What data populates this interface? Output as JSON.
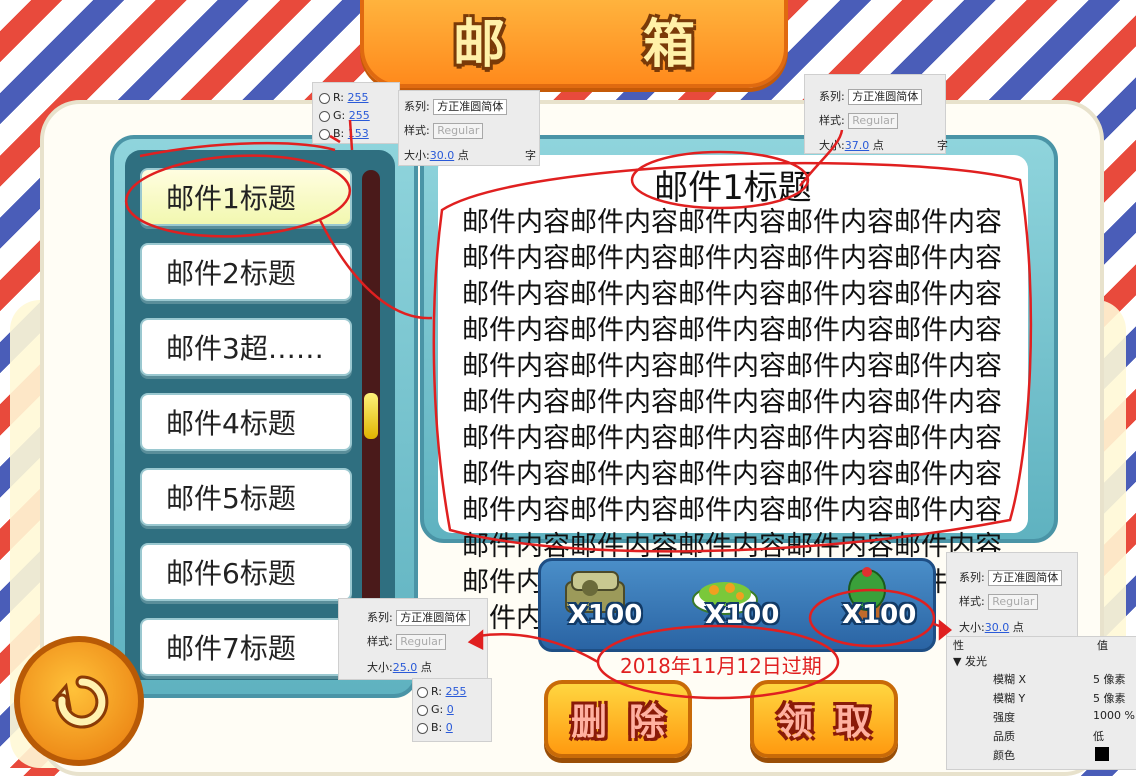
{
  "title": "邮 箱",
  "mail_list": [
    {
      "label": "邮件1标题"
    },
    {
      "label": "邮件2标题"
    },
    {
      "label": "邮件3超……"
    },
    {
      "label": "邮件4标题"
    },
    {
      "label": "邮件5标题"
    },
    {
      "label": "邮件6标题"
    },
    {
      "label": "邮件7标题"
    }
  ],
  "mail": {
    "title": "邮件1标题",
    "body": "邮件内容邮件内容邮件内容邮件内容邮件内容邮件内容邮件内容邮件内容邮件内容邮件内容邮件内容邮件内容邮件内容邮件内容邮件内容邮件内容邮件内容邮件内容邮件内容邮件内容邮件内容邮件内容邮件内容邮件内容邮件内容邮件内容邮件内容邮件内容邮件内容邮件内容邮件内容邮件内容邮件内容邮件内容邮件内容邮件内容邮件内容邮件内容邮件内容邮件内容邮件内容邮件内容邮件内容邮件内容邮件内容邮件内容邮件内容邮件内容邮件内容邮件内容邮件内容邮件内容邮件内容邮件内容邮件内容邮件内容邮件内容邮件内容"
  },
  "rewards": [
    {
      "icon": "sofa-icon",
      "qty": "X100"
    },
    {
      "icon": "salad-icon",
      "qty": "X100"
    },
    {
      "icon": "cactus-icon",
      "qty": "X100"
    }
  ],
  "expire_text": "2018年11月12日过期",
  "buttons": {
    "delete": "删除",
    "claim": "领取"
  },
  "annotations": {
    "color_list": {
      "r_label": "R:",
      "r": "255",
      "g_label": "G:",
      "g": "255",
      "b_label": "B:",
      "b": "153"
    },
    "font_list": {
      "family_label": "系列:",
      "family": "方正准圆简体",
      "style_label": "样式:",
      "style": "Regular",
      "size_label": "大小:",
      "size": "30.0",
      "unit": "点",
      "extra": "字"
    },
    "font_title": {
      "family_label": "系列:",
      "family": "方正准圆简体",
      "style_label": "样式:",
      "style": "Regular",
      "size_label": "大小:",
      "size": "37.0",
      "unit": "点",
      "extra": "字"
    },
    "font_expire": {
      "family_label": "系列:",
      "family": "方正准圆简体",
      "style_label": "样式:",
      "style": "Regular",
      "size_label": "大小:",
      "size": "25.0",
      "unit": "点"
    },
    "color_expire": {
      "r_label": "R:",
      "r": "255",
      "g_label": "G:",
      "g": "0",
      "b_label": "B:",
      "b": "0"
    },
    "font_qty": {
      "family_label": "系列:",
      "family": "方正准圆简体",
      "style_label": "样式:",
      "style": "Regular",
      "size_label": "大小:",
      "size": "30.0",
      "unit": "点"
    },
    "glow": {
      "header_left": "性",
      "header_right": "值",
      "section": "发光",
      "blur_x_label": "模糊 X",
      "blur_x": "5",
      "blur_x_unit": "像素",
      "blur_y_label": "模糊 Y",
      "blur_y": "5",
      "blur_y_unit": "像素",
      "strength_label": "强度",
      "strength": "1000",
      "strength_unit": "%",
      "quality_label": "品质",
      "quality": "低",
      "color_label": "颜色"
    }
  },
  "colors": {
    "annotation_red": "#e02020",
    "mail_title_color": "#ffff99",
    "glow_color": "#000000"
  }
}
